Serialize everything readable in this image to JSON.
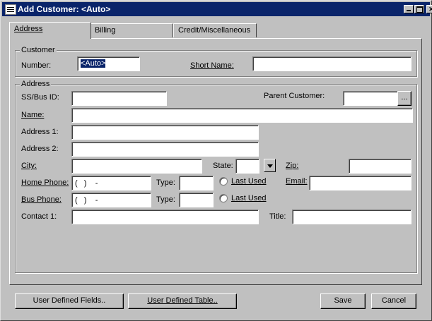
{
  "window": {
    "title": "Add Customer: <Auto>"
  },
  "tabs": [
    {
      "label": "Address"
    },
    {
      "label": "Billing"
    },
    {
      "label": "Credit/Miscellaneous"
    }
  ],
  "customer_group": {
    "title": "Customer",
    "number_label": "Number:",
    "number_value": "<Auto>",
    "short_name_label": "Short Name:",
    "short_name_value": ""
  },
  "address_group": {
    "title": "Address",
    "ss_bus_id_label": "SS/Bus ID:",
    "parent_customer_label": "Parent Customer:",
    "browse_label": "...",
    "name_label": "Name:",
    "address1_label": "Address 1:",
    "address2_label": "Address 2:",
    "city_label": "City:",
    "state_label": "State:",
    "zip_label": "Zip:",
    "home_phone_label": "Home Phone:",
    "home_phone_value": "(   )    -",
    "bus_phone_label": "Bus Phone:",
    "bus_phone_value": "(   )    -",
    "type_label": "Type:",
    "last_used_label": "Last Used",
    "email_label": "Email:",
    "contact1_label": "Contact 1:",
    "title_label": "Title:"
  },
  "buttons": {
    "user_defined_fields": "User Defined Fields..",
    "user_defined_table": "User Defined Table..",
    "save": "Save",
    "cancel": "Cancel"
  }
}
